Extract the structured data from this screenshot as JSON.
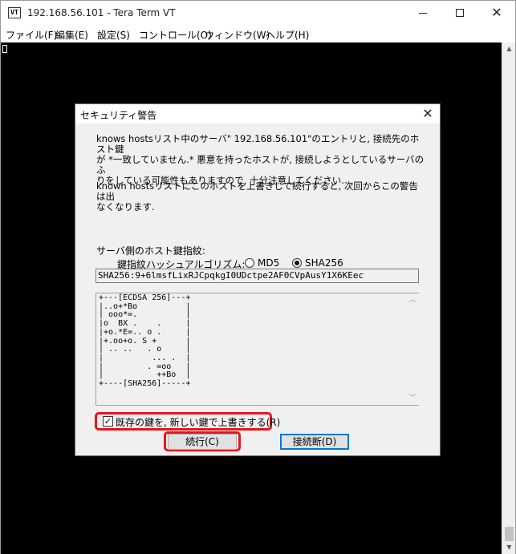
{
  "window": {
    "title": "192.168.56.101 - Tera Term VT",
    "icon_text": "VT"
  },
  "menu": {
    "items": [
      "ファイル(F)",
      "編集(E)",
      "設定(S)",
      "コントロール(O)",
      "ウィンドウ(W)",
      "ヘルプ(H)"
    ]
  },
  "dialog": {
    "title": "セキュリティ警告",
    "message1_line1": "knows hostsリスト中のサーバ\" 192.168.56.101\"のエントリと, 接続先のホスト鍵",
    "message1_line2": "が *一致していません.* 悪意を持ったホストが, 接続しようとしているサーバのふ",
    "message1_line3": "りをしている可能性もありますので, 十分注意してください.",
    "message2_line1": "known hostsリストにこのホストを上書きして続行すると, 次回からこの警告は出",
    "message2_line2": "なくなります.",
    "fingerprint_label": "サーバ側のホスト鍵指紋:",
    "algorithm_label": "鍵指紋ハッシュアルゴリズム:",
    "algorithm_options": [
      {
        "label": "MD5",
        "selected": false
      },
      {
        "label": "SHA256",
        "selected": true
      }
    ],
    "fingerprint_value": "SHA256:9+6lmsfLixRJCpqkgI0UDctpe2AF0CVpAusY1X6KEec",
    "randomart": "+---[ECDSA 256]---+\n|..o+*Bo          |\n| ooo*=.          |\n|o  BX .    .     |\n|+o.*E=.. o .     |\n|+.oo+o. S +      |\n| .. ..   . o     |\n|          ... .  |\n|         . =oo   |\n|           ++Bo  |\n+----[SHA256]-----+",
    "checkbox": {
      "label": "既存の鍵を, 新しい鍵で上書きする(R)",
      "checked": true
    },
    "buttons": {
      "continue": "続行(C)",
      "disconnect": "接続断(D)"
    }
  },
  "colors": {
    "highlight": "#e8141b",
    "terminal_bg": "#000000",
    "focus_border": "#0078d7"
  }
}
